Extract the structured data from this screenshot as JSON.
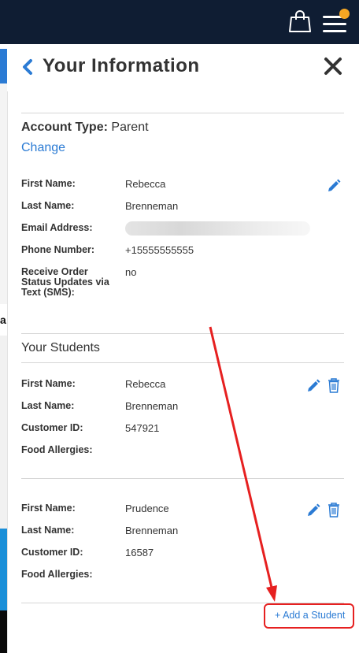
{
  "background": {
    "partial_letter": "a"
  },
  "header": {
    "bag_icon": "shopping-bag-icon",
    "menu_icon": "hamburger-menu-icon",
    "notification_color": "#f5a623"
  },
  "panel": {
    "title": "Your Information",
    "account_type_label": "Account Type:",
    "account_type_value": "Parent",
    "change_label": "Change",
    "parent": {
      "first_name_label": "First Name:",
      "first_name": "Rebecca",
      "last_name_label": "Last Name:",
      "last_name": "Brenneman",
      "email_label": "Email Address:",
      "phone_label": "Phone Number:",
      "phone": "+15555555555",
      "sms_label": "Receive Order Status Updates via Text (SMS):",
      "sms": "no"
    },
    "students_title": "Your Students",
    "students": [
      {
        "first_name_label": "First Name:",
        "first_name": "Rebecca",
        "last_name_label": "Last Name:",
        "last_name": "Brenneman",
        "customer_id_label": "Customer ID:",
        "customer_id": "547921",
        "food_allergies_label": "Food Allergies:"
      },
      {
        "first_name_label": "First Name:",
        "first_name": "Prudence",
        "last_name_label": "Last Name:",
        "last_name": "Brenneman",
        "customer_id_label": "Customer ID:",
        "customer_id": "16587",
        "food_allergies_label": "Food Allergies:"
      }
    ],
    "add_student_label": "+ Add a Student"
  },
  "colors": {
    "accent": "#2b7bd4",
    "annotation": "#e62020",
    "header_bg": "#0f1d33"
  }
}
